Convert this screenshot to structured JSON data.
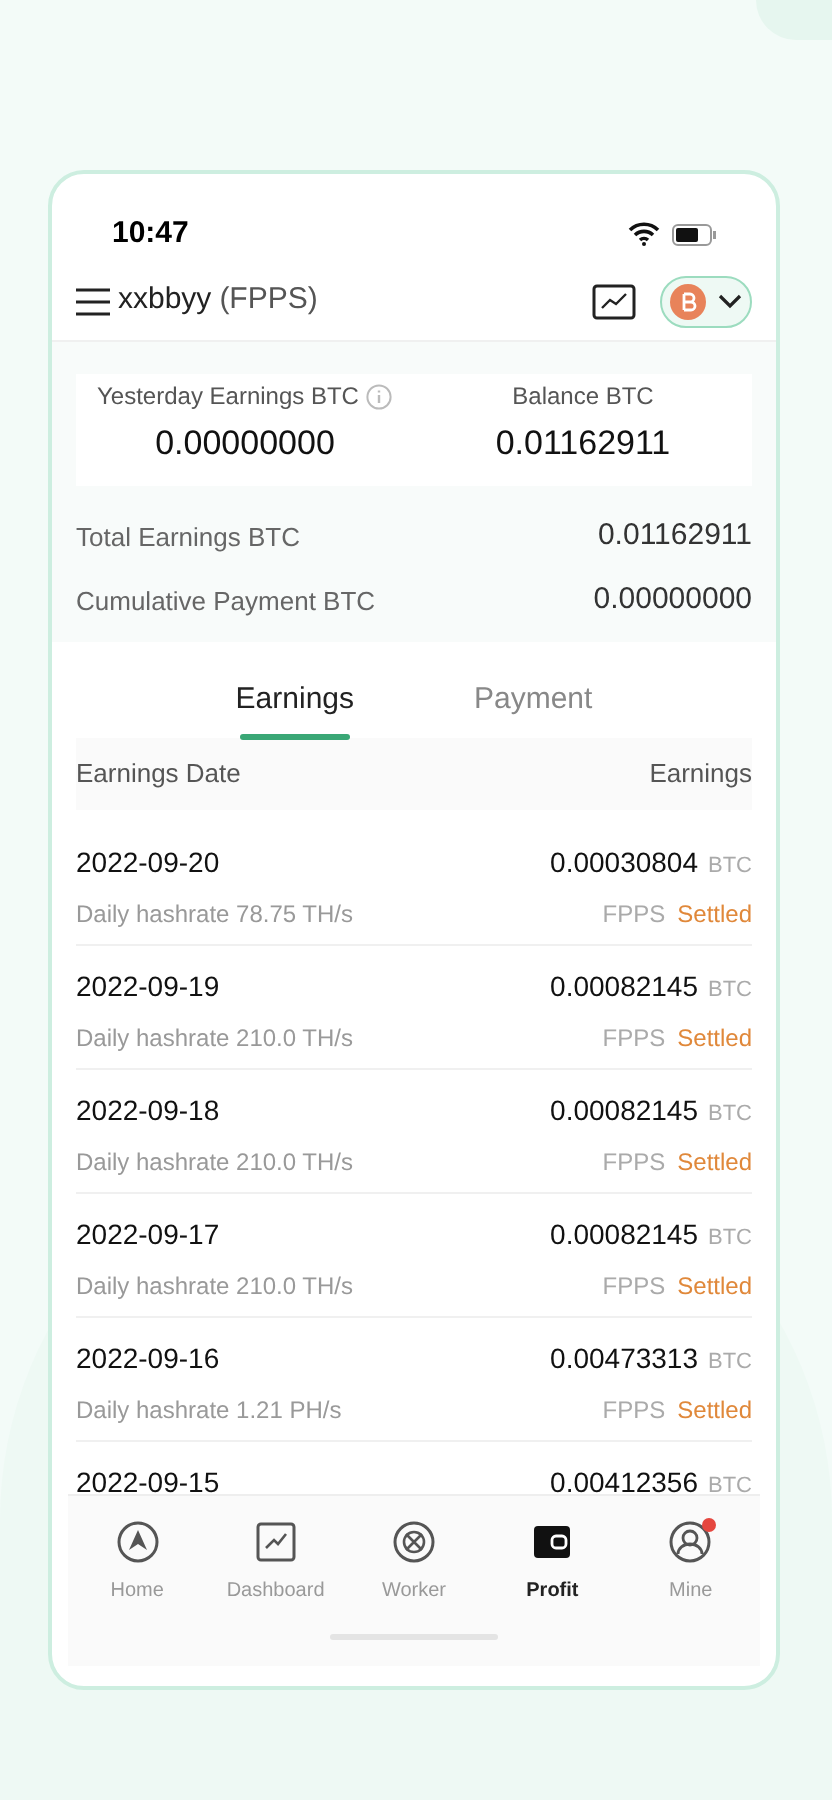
{
  "status_bar": {
    "time": "10:47"
  },
  "header": {
    "title": "xxbbyy",
    "mode": "(FPPS)"
  },
  "summary": {
    "yesterday_label": "Yesterday Earnings BTC",
    "yesterday_value": "0.00000000",
    "balance_label": "Balance BTC",
    "balance_value": "0.01162911",
    "totals": [
      {
        "label": "Total Earnings BTC",
        "value": "0.01162911"
      },
      {
        "label": "Cumulative Payment BTC",
        "value": "0.00000000"
      }
    ]
  },
  "tabs": [
    {
      "label": "Earnings",
      "selected": true
    },
    {
      "label": "Payment",
      "selected": false
    }
  ],
  "table": {
    "columns": [
      "Earnings Date",
      "Earnings"
    ],
    "rows": [
      {
        "date": "2022-09-20",
        "amount": "0.00030804",
        "unit": "BTC",
        "hashrate": "Daily hashrate 78.75 TH/s",
        "mode": "FPPS",
        "status": "Settled"
      },
      {
        "date": "2022-09-19",
        "amount": "0.00082145",
        "unit": "BTC",
        "hashrate": "Daily hashrate 210.0 TH/s",
        "mode": "FPPS",
        "status": "Settled"
      },
      {
        "date": "2022-09-18",
        "amount": "0.00082145",
        "unit": "BTC",
        "hashrate": "Daily hashrate 210.0 TH/s",
        "mode": "FPPS",
        "status": "Settled"
      },
      {
        "date": "2022-09-17",
        "amount": "0.00082145",
        "unit": "BTC",
        "hashrate": "Daily hashrate 210.0 TH/s",
        "mode": "FPPS",
        "status": "Settled"
      },
      {
        "date": "2022-09-16",
        "amount": "0.00473313",
        "unit": "BTC",
        "hashrate": "Daily hashrate 1.21 PH/s",
        "mode": "FPPS",
        "status": "Settled"
      },
      {
        "date": "2022-09-15",
        "amount": "0.00412356",
        "unit": "BTC"
      }
    ]
  },
  "nav": [
    {
      "label": "Home",
      "kind": "home",
      "selected": false,
      "badge": false
    },
    {
      "label": "Dashboard",
      "kind": "dashboard",
      "selected": false,
      "badge": false
    },
    {
      "label": "Worker",
      "kind": "worker",
      "selected": false,
      "badge": false
    },
    {
      "label": "Profit",
      "kind": "profit",
      "selected": true,
      "badge": false
    },
    {
      "label": "Mine",
      "kind": "mine",
      "selected": false,
      "badge": true
    }
  ]
}
